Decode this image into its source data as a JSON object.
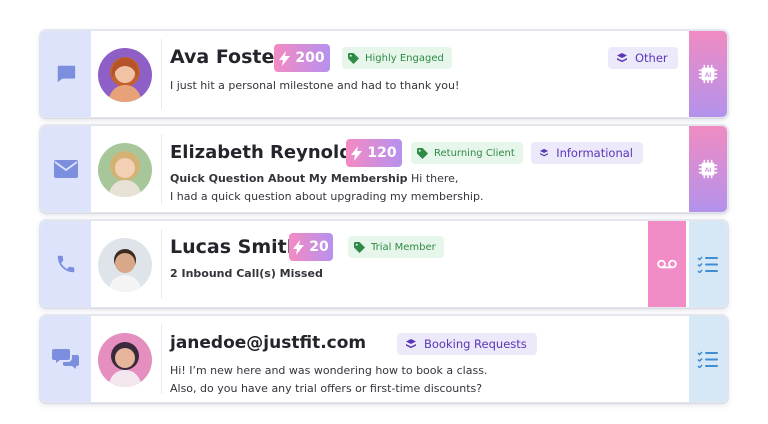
{
  "colors": {
    "channel_bg": "#dde3fb",
    "channel_icon": "#7c8fde",
    "score_gradient": [
      "#f48ac3",
      "#b691ee"
    ],
    "tag_bg": "#e7f6ea",
    "tag_text": "#2f8a45",
    "category_bg": "#ece9fb",
    "category_text": "#5a36b6",
    "ai_gradient": [
      "#f08bc2",
      "#b392ec"
    ],
    "task_bg": "#d6e7f6",
    "task_icon": "#3f8ed4",
    "voicemail_bg": "#f28cc6"
  },
  "conversations": [
    {
      "channel_icon": "chat-bubble-icon",
      "name": "Ava Foster",
      "score": "200",
      "tag": "Highly Engaged",
      "category": "Other",
      "message": "I just hit a personal milestone and had to thank you!",
      "action": "ai-chip-icon"
    },
    {
      "channel_icon": "envelope-icon",
      "name": "Elizabeth Reynolds",
      "score": "120",
      "tag": "Returning Client",
      "category": "Informational",
      "subject": "Quick Question About My Membership",
      "message_line1": " Hi there,",
      "message_line2": "I had a quick question about upgrading my membership.",
      "action": "ai-chip-icon"
    },
    {
      "channel_icon": "phone-icon",
      "name": "Lucas Smith",
      "score": "20",
      "tag": "Trial Member",
      "missed_calls": "2 Inbound Call(s) Missed",
      "actions": [
        "voicemail-icon",
        "task-list-icon"
      ]
    },
    {
      "channel_icon": "sms-bubbles-icon",
      "name": "janedoe@justfit.com",
      "category": "Booking Requests",
      "message_line1": "Hi! I’m new here and was wondering how to book a class.",
      "message_line2": "Also, do you have any trial offers or first-time discounts?",
      "action": "task-list-icon"
    }
  ]
}
